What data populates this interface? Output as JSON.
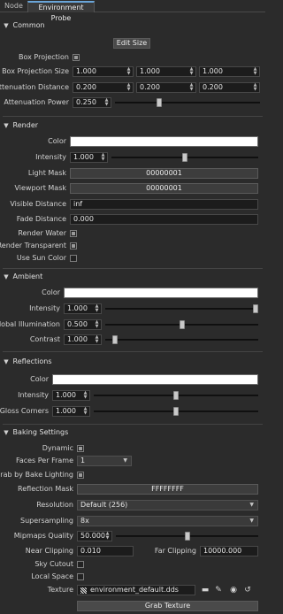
{
  "tabs": [
    {
      "label": "Node",
      "active": false
    },
    {
      "label": "Environment Probe",
      "active": true
    }
  ],
  "common": {
    "title": "Common",
    "edit_size": "Edit Size",
    "box_projection": {
      "label": "Box Projection",
      "checked": true
    },
    "box_projection_size": {
      "label": "Box Projection Size",
      "values": [
        "1.000",
        "1.000",
        "1.000"
      ]
    },
    "attenuation_distance": {
      "label": "Attenuation Distance",
      "values": [
        "0.200",
        "0.200",
        "0.200"
      ]
    },
    "attenuation_power": {
      "label": "Attenuation Power",
      "value": "0.250",
      "slider": 0.3
    }
  },
  "render": {
    "title": "Render",
    "color": {
      "label": "Color",
      "value": "#ffffff"
    },
    "intensity": {
      "label": "Intensity",
      "value": "1.000",
      "slider": 0.5
    },
    "light_mask": {
      "label": "Light Mask",
      "value": "00000001"
    },
    "viewport_mask": {
      "label": "Viewport Mask",
      "value": "00000001"
    },
    "visible_distance": {
      "label": "Visible Distance",
      "value": "inf"
    },
    "fade_distance": {
      "label": "Fade Distance",
      "value": "0.000"
    },
    "render_water": {
      "label": "Render Water",
      "checked": true
    },
    "render_transparent": {
      "label": "Render Transparent",
      "checked": true
    },
    "use_sun_color": {
      "label": "Use Sun Color",
      "checked": false
    }
  },
  "ambient": {
    "title": "Ambient",
    "color": {
      "label": "Color",
      "value": "#ffffff"
    },
    "intensity": {
      "label": "Intensity",
      "value": "1.000",
      "slider": 1.0
    },
    "global_illumination": {
      "label": "Global Illumination",
      "value": "0.500",
      "slider": 0.5
    },
    "contrast": {
      "label": "Contrast",
      "value": "1.000",
      "slider": 0.05
    }
  },
  "reflections": {
    "title": "Reflections",
    "color": {
      "label": "Color",
      "value": "#ffffff"
    },
    "intensity": {
      "label": "Intensity",
      "value": "1.000",
      "slider": 0.5
    },
    "gloss_corners": {
      "label": "Gloss Corners",
      "value": "1.000",
      "slider": 0.5
    }
  },
  "baking": {
    "title": "Baking Settings",
    "dynamic": {
      "label": "Dynamic",
      "checked": true
    },
    "faces_per_frame": {
      "label": "Faces Per Frame",
      "value": "1"
    },
    "grab_by_bake_lighting": {
      "label": "Grab by Bake Lighting",
      "checked": true
    },
    "reflection_mask": {
      "label": "Reflection Mask",
      "value": "FFFFFFFF"
    },
    "resolution": {
      "label": "Resolution",
      "value": "Default (256)"
    },
    "supersampling": {
      "label": "Supersampling",
      "value": "8x"
    },
    "mipmaps_quality": {
      "label": "Mipmaps Quality",
      "value": "50.000",
      "slider": 0.5
    },
    "near_clipping": {
      "label": "Near Clipping",
      "value": "0.010"
    },
    "far_clipping": {
      "label": "Far Clipping",
      "value": "10000.000"
    },
    "sky_cutout": {
      "label": "Sky Cutout",
      "checked": false
    },
    "local_space": {
      "label": "Local Space",
      "checked": false
    },
    "texture": {
      "label": "Texture",
      "value": "environment_default.dds"
    },
    "grab_texture": "Grab Texture"
  },
  "icons": {
    "section_chevron": "chevron-down-icon",
    "folder": "folder-icon",
    "edit": "edit-icon",
    "view": "eye-icon",
    "reset": "reset-icon"
  }
}
